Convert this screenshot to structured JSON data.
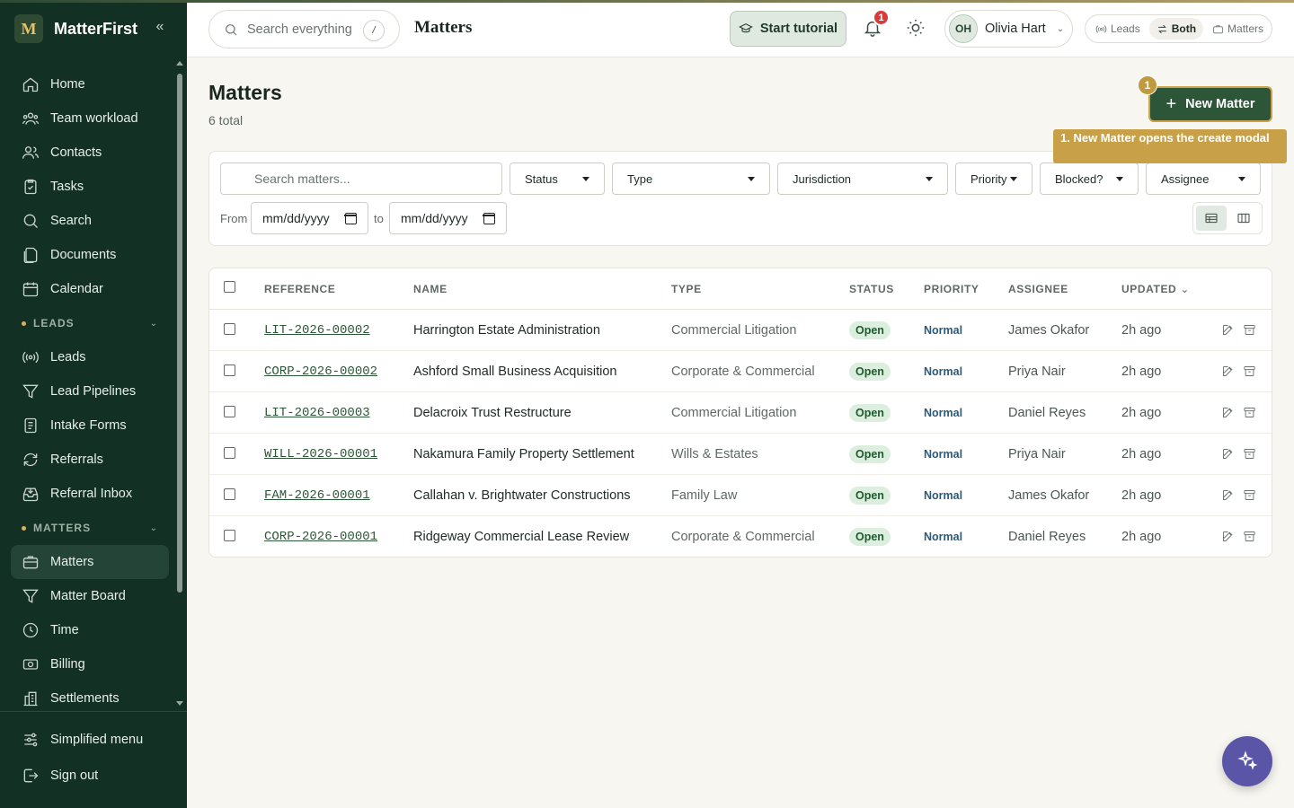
{
  "app": {
    "brand_initial": "M",
    "brand_name": "MatterFirst"
  },
  "sidebar": {
    "items_top": [
      {
        "label": "Home",
        "icon": "home-icon"
      },
      {
        "label": "Team workload",
        "icon": "team-icon"
      },
      {
        "label": "Contacts",
        "icon": "contacts-icon"
      },
      {
        "label": "Tasks",
        "icon": "tasks-icon"
      },
      {
        "label": "Search",
        "icon": "search-icon"
      },
      {
        "label": "Documents",
        "icon": "documents-icon"
      },
      {
        "label": "Calendar",
        "icon": "calendar-icon"
      }
    ],
    "section_leads": "LEADS",
    "items_leads": [
      {
        "label": "Leads",
        "icon": "broadcast-icon"
      },
      {
        "label": "Lead Pipelines",
        "icon": "funnel-icon"
      },
      {
        "label": "Intake Forms",
        "icon": "form-icon"
      },
      {
        "label": "Referrals",
        "icon": "refresh-icon"
      },
      {
        "label": "Referral Inbox",
        "icon": "inbox-icon"
      }
    ],
    "section_matters": "MATTERS",
    "items_matters": [
      {
        "label": "Matters",
        "icon": "briefcase-icon",
        "active": true
      },
      {
        "label": "Matter Board",
        "icon": "funnel-icon"
      },
      {
        "label": "Time",
        "icon": "clock-icon"
      },
      {
        "label": "Billing",
        "icon": "money-icon"
      },
      {
        "label": "Settlements",
        "icon": "building-icon"
      }
    ],
    "footer": [
      {
        "label": "Simplified menu",
        "icon": "sliders-icon"
      },
      {
        "label": "Sign out",
        "icon": "logout-icon"
      }
    ]
  },
  "topbar": {
    "search_placeholder": "Search everything",
    "search_shortcut": "/",
    "page_title": "Matters",
    "tutorial_label": "Start tutorial",
    "notification_count": "1",
    "user_initials": "OH",
    "user_name": "Olivia Hart",
    "mode_options": [
      "Leads",
      "Both",
      "Matters"
    ],
    "mode_selected": "Both"
  },
  "main": {
    "title": "Matters",
    "subtitle": "6 total",
    "new_button": "New Matter",
    "tutorial_step": "1",
    "tooltip": "1. New Matter opens the create modal"
  },
  "filters": {
    "search_placeholder": "Search matters...",
    "status": "Status",
    "type": "Type",
    "jurisdiction": "Jurisdiction",
    "priority": "Priority",
    "blocked": "Blocked?",
    "assignee": "Assignee",
    "from_label": "From",
    "to_label": "to",
    "date_placeholder": "mm/dd/yyyy"
  },
  "table": {
    "headers": {
      "reference": "REFERENCE",
      "name": "NAME",
      "type": "TYPE",
      "status": "STATUS",
      "priority": "PRIORITY",
      "assignee": "ASSIGNEE",
      "updated": "UPDATED"
    },
    "rows": [
      {
        "reference": "LIT-2026-00002",
        "name": "Harrington Estate Administration",
        "type": "Commercial Litigation",
        "status": "Open",
        "priority": "Normal",
        "assignee": "James Okafor",
        "updated": "2h ago"
      },
      {
        "reference": "CORP-2026-00002",
        "name": "Ashford Small Business Acquisition",
        "type": "Corporate & Commercial",
        "status": "Open",
        "priority": "Normal",
        "assignee": "Priya Nair",
        "updated": "2h ago"
      },
      {
        "reference": "LIT-2026-00003",
        "name": "Delacroix Trust Restructure",
        "type": "Commercial Litigation",
        "status": "Open",
        "priority": "Normal",
        "assignee": "Daniel Reyes",
        "updated": "2h ago"
      },
      {
        "reference": "WILL-2026-00001",
        "name": "Nakamura Family Property Settlement",
        "type": "Wills & Estates",
        "status": "Open",
        "priority": "Normal",
        "assignee": "Priya Nair",
        "updated": "2h ago"
      },
      {
        "reference": "FAM-2026-00001",
        "name": "Callahan v. Brightwater Constructions",
        "type": "Family Law",
        "status": "Open",
        "priority": "Normal",
        "assignee": "James Okafor",
        "updated": "2h ago"
      },
      {
        "reference": "CORP-2026-00001",
        "name": "Ridgeway Commercial Lease Review",
        "type": "Corporate & Commercial",
        "status": "Open",
        "priority": "Normal",
        "assignee": "Daniel Reyes",
        "updated": "2h ago"
      }
    ]
  }
}
